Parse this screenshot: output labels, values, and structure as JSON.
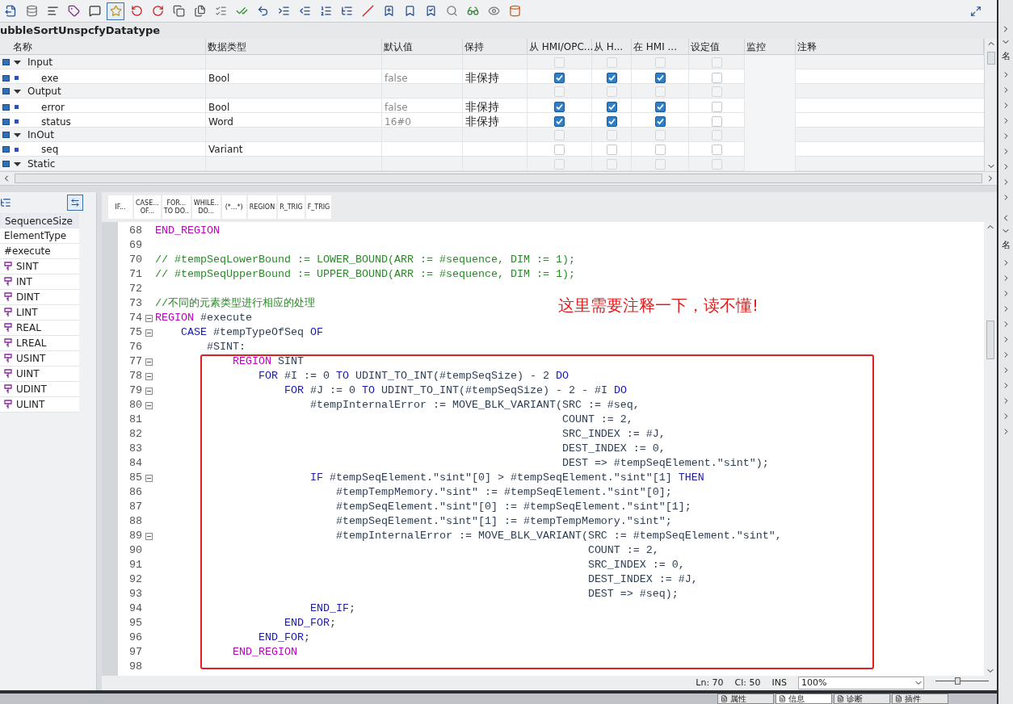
{
  "block_title": "ubbleSortUnspcfyDatatype",
  "table": {
    "columns": [
      "名称",
      "数据类型",
      "默认值",
      "保持",
      "从 HMI/OPC...",
      "从 H...",
      "在 HMI ...",
      "设定值",
      "监控",
      "注释"
    ],
    "rows": [
      {
        "kind": "section",
        "name": "Input",
        "expanded": true,
        "flags": [
          {
            "checked": false
          },
          {
            "checked": false
          },
          {
            "checked": false
          },
          {
            "checked": false
          }
        ]
      },
      {
        "kind": "member",
        "name": "exe",
        "type": "Bool",
        "default": "false",
        "retain": "非保持",
        "flags": [
          {
            "checked": true
          },
          {
            "checked": true
          },
          {
            "checked": true
          },
          {
            "checked": false
          }
        ]
      },
      {
        "kind": "section",
        "name": "Output",
        "expanded": true,
        "flags": [
          {
            "checked": false
          },
          {
            "checked": false
          },
          {
            "checked": false
          },
          {
            "checked": false
          }
        ]
      },
      {
        "kind": "member",
        "name": "error",
        "type": "Bool",
        "default": "false",
        "retain": "非保持",
        "flags": [
          {
            "checked": true
          },
          {
            "checked": true
          },
          {
            "checked": true
          },
          {
            "checked": false
          }
        ]
      },
      {
        "kind": "member",
        "name": "status",
        "type": "Word",
        "default": "16#0",
        "retain": "非保持",
        "flags": [
          {
            "checked": true
          },
          {
            "checked": true
          },
          {
            "checked": true
          },
          {
            "checked": false
          }
        ]
      },
      {
        "kind": "section",
        "name": "InOut",
        "expanded": true,
        "flags": [
          {
            "checked": false
          },
          {
            "checked": false
          },
          {
            "checked": false
          },
          {
            "checked": false
          }
        ]
      },
      {
        "kind": "member",
        "name": "seq",
        "type": "Variant",
        "flags": [
          {
            "checked": false
          },
          {
            "checked": false
          },
          {
            "checked": false
          },
          {
            "checked": false
          }
        ]
      },
      {
        "kind": "section",
        "name": "Static",
        "expanded": true,
        "flags": [
          {
            "checked": false
          },
          {
            "checked": false
          },
          {
            "checked": false
          },
          {
            "checked": false
          }
        ]
      }
    ]
  },
  "outline": {
    "items": [
      {
        "kind": "plain",
        "label": "SequenceSize",
        "selected": true
      },
      {
        "kind": "plain",
        "label": "ElementType",
        "selected": false
      },
      {
        "kind": "plain",
        "label": "#execute",
        "selected": false
      },
      {
        "kind": "region",
        "label": "SINT",
        "selected": false
      },
      {
        "kind": "region",
        "label": "INT",
        "selected": false
      },
      {
        "kind": "region",
        "label": "DINT",
        "selected": false
      },
      {
        "kind": "region",
        "label": "LINT",
        "selected": false
      },
      {
        "kind": "region",
        "label": "REAL",
        "selected": false
      },
      {
        "kind": "region",
        "label": "LREAL",
        "selected": false
      },
      {
        "kind": "region",
        "label": "USINT",
        "selected": false
      },
      {
        "kind": "region",
        "label": "UINT",
        "selected": false
      },
      {
        "kind": "region",
        "label": "UDINT",
        "selected": false
      },
      {
        "kind": "region",
        "label": "ULINT",
        "selected": false
      }
    ]
  },
  "snippets": [
    [
      "IF..."
    ],
    [
      "CASE...",
      "OF..."
    ],
    [
      "FOR...",
      "TO DO.."
    ],
    [
      "WHILE..",
      "DO..."
    ],
    [
      "(*...*)"
    ],
    [
      "REGION"
    ],
    [
      "R_TRIG"
    ],
    [
      "F_TRIG"
    ]
  ],
  "code": [
    {
      "no": "68",
      "fold": false,
      "segments": [
        {
          "kind": "region",
          "text": "END_REGION"
        }
      ]
    },
    {
      "no": "69",
      "fold": false
    },
    {
      "no": "70",
      "fold": false,
      "segments": [
        {
          "kind": "comment",
          "text": "// #tempSeqLowerBound := LOWER_BOUND(ARR := #sequence, DIM := 1);"
        }
      ]
    },
    {
      "no": "71",
      "fold": false,
      "segments": [
        {
          "kind": "comment",
          "text": "// #tempSeqUpperBound := UPPER_BOUND(ARR := #sequence, DIM := 1);"
        }
      ]
    },
    {
      "no": "72",
      "fold": false
    },
    {
      "no": "73",
      "fold": false,
      "segments": [
        {
          "kind": "comment",
          "text": "//不同的元素类型进行相应的处理"
        }
      ]
    },
    {
      "no": "74",
      "fold": true,
      "segments": [
        {
          "kind": "region",
          "text": "REGION"
        },
        {
          "kind": "plain",
          "text": " #execute"
        }
      ]
    },
    {
      "no": "75",
      "fold": true,
      "segments": [
        {
          "kind": "keyword",
          "text": "    CASE"
        },
        {
          "kind": "plain",
          "text": " #tempTypeOfSeq "
        },
        {
          "kind": "keyword",
          "text": "OF"
        }
      ]
    },
    {
      "no": "76",
      "fold": false,
      "segments": [
        {
          "kind": "plain",
          "text": "        #SINT:"
        }
      ]
    },
    {
      "no": "77",
      "fold": true,
      "segments": [
        {
          "kind": "region",
          "text": "            REGION"
        },
        {
          "kind": "plain",
          "text": " SINT"
        }
      ]
    },
    {
      "no": "78",
      "fold": true,
      "segments": [
        {
          "kind": "keyword",
          "text": "                FOR"
        },
        {
          "kind": "plain",
          "text": " #I := 0 "
        },
        {
          "kind": "keyword",
          "text": "TO"
        },
        {
          "kind": "plain",
          "text": " UDINT_TO_INT(#tempSeqSize) - 2 "
        },
        {
          "kind": "keyword",
          "text": "DO"
        }
      ]
    },
    {
      "no": "79",
      "fold": true,
      "segments": [
        {
          "kind": "keyword",
          "text": "                    FOR"
        },
        {
          "kind": "plain",
          "text": " #J := 0 "
        },
        {
          "kind": "keyword",
          "text": "TO"
        },
        {
          "kind": "plain",
          "text": " UDINT_TO_INT(#tempSeqSize) - 2 - #I "
        },
        {
          "kind": "keyword",
          "text": "DO"
        }
      ]
    },
    {
      "no": "80",
      "fold": true,
      "segments": [
        {
          "kind": "plain",
          "text": "                        #tempInternalError := MOVE_BLK_VARIANT(SRC := #seq,"
        }
      ]
    },
    {
      "no": "81",
      "fold": false,
      "segments": [
        {
          "kind": "plain",
          "text": "                                                               COUNT := 2,"
        }
      ]
    },
    {
      "no": "82",
      "fold": false,
      "segments": [
        {
          "kind": "plain",
          "text": "                                                               SRC_INDEX := #J,"
        }
      ]
    },
    {
      "no": "83",
      "fold": false,
      "segments": [
        {
          "kind": "plain",
          "text": "                                                               DEST_INDEX := 0,"
        }
      ]
    },
    {
      "no": "84",
      "fold": false,
      "segments": [
        {
          "kind": "plain",
          "text": "                                                               DEST => #tempSeqElement.\"sint\");"
        }
      ]
    },
    {
      "no": "85",
      "fold": true,
      "segments": [
        {
          "kind": "keyword",
          "text": "                        IF"
        },
        {
          "kind": "plain",
          "text": " #tempSeqElement.\"sint\"[0] > #tempSeqElement.\"sint\"[1] "
        },
        {
          "kind": "keyword",
          "text": "THEN"
        }
      ]
    },
    {
      "no": "86",
      "fold": false,
      "segments": [
        {
          "kind": "plain",
          "text": "                            #tempTempMemory.\"sint\" := #tempSeqElement.\"sint\"[0];"
        }
      ]
    },
    {
      "no": "87",
      "fold": false,
      "segments": [
        {
          "kind": "plain",
          "text": "                            #tempSeqElement.\"sint\"[0] := #tempSeqElement.\"sint\"[1];"
        }
      ]
    },
    {
      "no": "88",
      "fold": false,
      "segments": [
        {
          "kind": "plain",
          "text": "                            #tempSeqElement.\"sint\"[1] := #tempTempMemory.\"sint\";"
        }
      ]
    },
    {
      "no": "89",
      "fold": true,
      "segments": [
        {
          "kind": "plain",
          "text": "                            #tempInternalError := MOVE_BLK_VARIANT(SRC := #tempSeqElement.\"sint\","
        }
      ]
    },
    {
      "no": "90",
      "fold": false,
      "segments": [
        {
          "kind": "plain",
          "text": "                                                                   COUNT := 2,"
        }
      ]
    },
    {
      "no": "91",
      "fold": false,
      "segments": [
        {
          "kind": "plain",
          "text": "                                                                   SRC_INDEX := 0,"
        }
      ]
    },
    {
      "no": "92",
      "fold": false,
      "segments": [
        {
          "kind": "plain",
          "text": "                                                                   DEST_INDEX := #J,"
        }
      ]
    },
    {
      "no": "93",
      "fold": false,
      "segments": [
        {
          "kind": "plain",
          "text": "                                                                   DEST => #seq);"
        }
      ]
    },
    {
      "no": "94",
      "fold": false,
      "segments": [
        {
          "kind": "keyword",
          "text": "                        END_IF"
        },
        {
          "kind": "plain",
          "text": ";"
        }
      ]
    },
    {
      "no": "95",
      "fold": false,
      "segments": [
        {
          "kind": "keyword",
          "text": "                    END_FOR"
        },
        {
          "kind": "plain",
          "text": ";"
        }
      ]
    },
    {
      "no": "96",
      "fold": false,
      "segments": [
        {
          "kind": "keyword",
          "text": "                END_FOR"
        },
        {
          "kind": "plain",
          "text": ";"
        }
      ]
    },
    {
      "no": "97",
      "fold": false,
      "segments": [
        {
          "kind": "region",
          "text": "            END_REGION"
        }
      ]
    },
    {
      "no": "98",
      "fold": false
    }
  ],
  "annotation": {
    "text": "这里需要注释一下，读不懂!"
  },
  "status_bar": {
    "line": "Ln: 70",
    "column": "Cl: 50",
    "mode": "INS",
    "zoom": "100%",
    "zoom_slider": {
      "level": 0.4
    }
  },
  "bottom_tabs": [
    {
      "label": "属性",
      "selected": false
    },
    {
      "label": "信息",
      "selected": true
    },
    {
      "label": "诊断",
      "selected": false
    },
    {
      "label": "插件",
      "selected": false
    }
  ],
  "right_strip": {
    "labels": [
      "名",
      "名"
    ]
  }
}
